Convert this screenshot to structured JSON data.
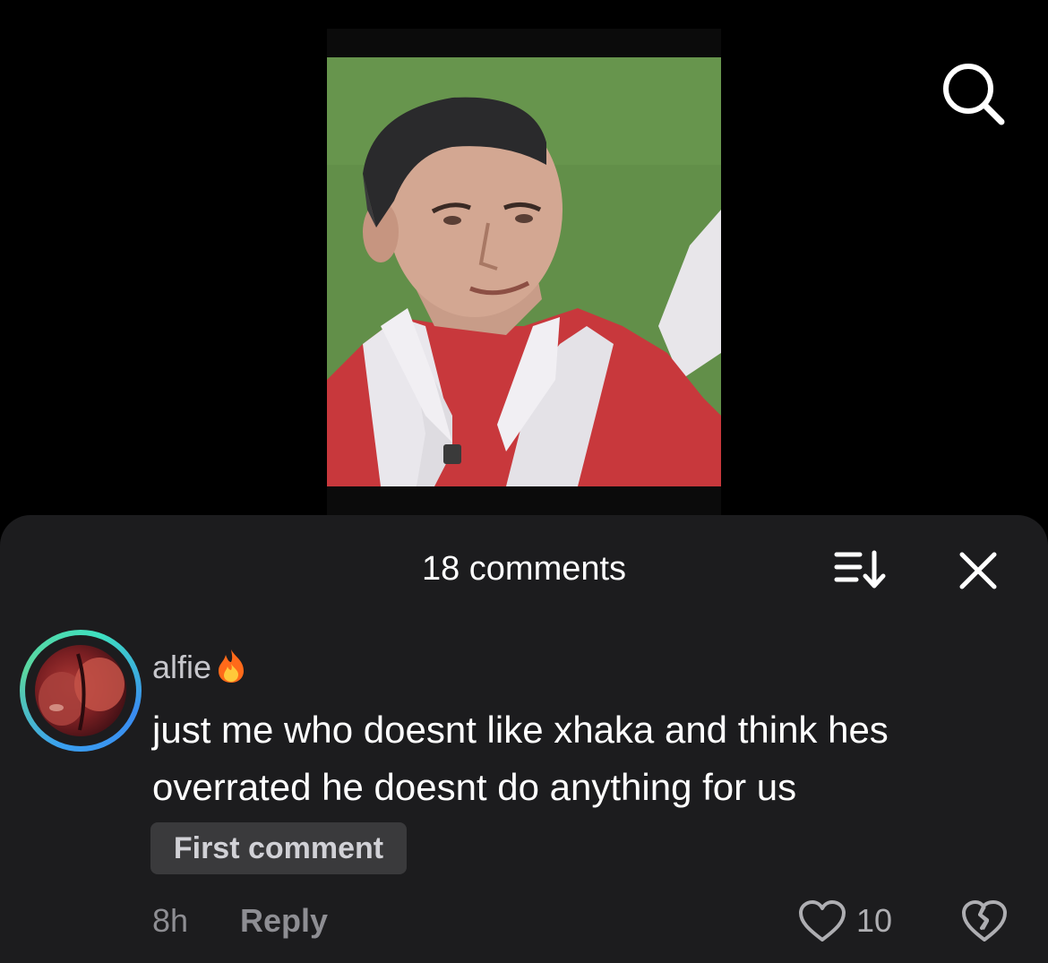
{
  "video": {
    "thumbnail_icon": "player-photo"
  },
  "toolbar": {
    "search_icon": "search-icon"
  },
  "comments_sheet": {
    "title": "18 comments",
    "sort_icon": "sort-icon",
    "close_icon": "close-icon"
  },
  "comment": {
    "username": "alfie",
    "username_emoji": "fire-icon",
    "text": "just me who doesnt like xhaka and think hes overrated he doesnt do anything for us",
    "badge": "First comment",
    "time": "8h",
    "reply_label": "Reply",
    "like_count": "10"
  },
  "colors": {
    "sheet_background": "#1c1c1e",
    "badge_background": "#3a3a3c",
    "secondary_text": "#8e8e93",
    "avatar_ring": "#3aa0f0"
  }
}
